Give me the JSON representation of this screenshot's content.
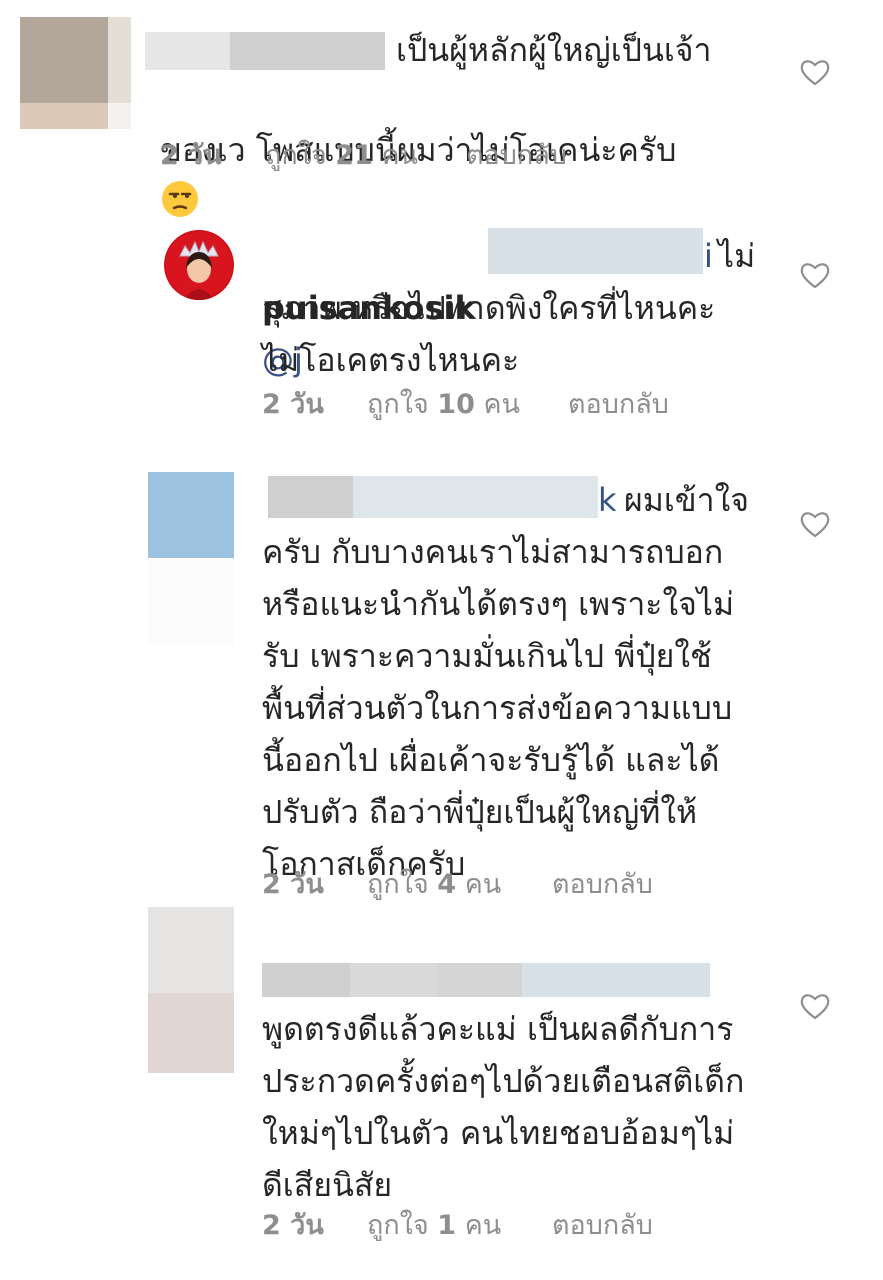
{
  "comments": [
    {
      "id": "c1",
      "username": "",
      "text_line1": "เป็นผู้หลักผู้ใหญ่เป็นเจ้า",
      "text_line2": "ของเว โพสแบบนี้ผมว่าไม่โอเคน่ะครับ",
      "emoji": "unamused-face-emoji",
      "age": "2 วัน",
      "likes_prefix": "ถูกใจ",
      "likes_count": "21",
      "likes_suffix": "คน",
      "reply_label": "ตอบกลับ"
    },
    {
      "id": "c2",
      "username": "puisankosik",
      "mention_prefix": "@j",
      "mention_suffix": "i",
      "text_line1_tail": "ไม่",
      "text_line2": "สุภาพ หรือไปพาดพิงใครที่ไหนคะ",
      "text_line3": "ไม่โอเคตรงไหนคะ",
      "age": "2 วัน",
      "likes_prefix": "ถูกใจ",
      "likes_count": "10",
      "likes_suffix": "คน",
      "reply_label": "ตอบกลับ"
    },
    {
      "id": "c3",
      "mention_tail": "k",
      "text_line1_tail": "ผมเข้าใจ",
      "text_rest": "ครับ กับบางคนเราไม่สามารถบอก\nหรือแนะนำกันได้ตรงๆ เพราะใจไม่\nรับ เพราะความมั่นเกินไป พี่ปุ๋ยใช้\nพื้นที่ส่วนตัวในการส่งข้อความแบบ\nนี้ออกไป เผื่อเค้าจะรับรู้ได้ และได้\nปรับตัว ถือว่าพี่ปุ๋ยเป็นผู้ใหญ่ที่ให้\nโอกาสเด็กครับ",
      "age": "2 วัน",
      "likes_prefix": "ถูกใจ",
      "likes_count": "4",
      "likes_suffix": "คน",
      "reply_label": "ตอบกลับ"
    },
    {
      "id": "c4",
      "text_rest": "พูดตรงดีแล้วคะแม่ เป็นผลดีกับการ\nประกวดครั้งต่อๆไปด้วยเตือนสติเด็ก\nใหม่ๆไปในตัว คนไทยชอบอ้อมๆไม่\nดีเสียนิสัย",
      "age": "2 วัน",
      "likes_prefix": "ถูกใจ",
      "likes_count": "1",
      "likes_suffix": "คน",
      "reply_label": "ตอบกลับ"
    }
  ],
  "colors": {
    "text": "#262626",
    "meta": "#8e8e8e",
    "mention": "#385185",
    "heart_stroke": "#8e8e8e"
  }
}
